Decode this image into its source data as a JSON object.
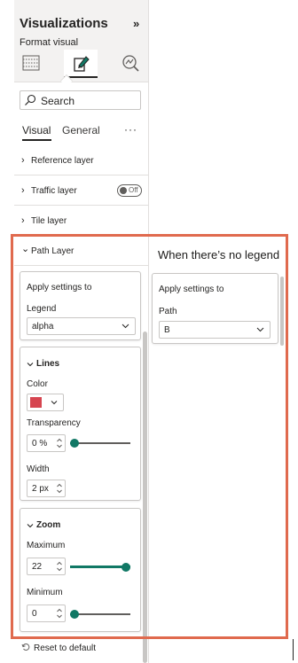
{
  "pane": {
    "title": "Visualizations",
    "collapse_glyph": "»",
    "subtitle": "Format visual",
    "icons": [
      "build-visual-icon",
      "format-visual-icon",
      "analytics-icon"
    ]
  },
  "search": {
    "placeholder": "Search",
    "icon": "search-icon"
  },
  "tabs": [
    {
      "label": "Visual",
      "active": true
    },
    {
      "label": "General",
      "active": false
    }
  ],
  "more_glyph": "···",
  "sections": {
    "reference": {
      "label": "Reference layer",
      "chevron": "›"
    },
    "traffic": {
      "label": "Traffic layer",
      "chevron": "›",
      "toggle_label": "Off"
    },
    "tile": {
      "label": "Tile layer",
      "chevron": "›"
    },
    "path": {
      "label": "Path Layer",
      "chevron": "⌄"
    }
  },
  "apply_card": {
    "title": "Apply settings to",
    "field_label": "Legend",
    "value": "alpha"
  },
  "lines_card": {
    "title": "Lines",
    "color_label": "Color",
    "color_value": "#d64550",
    "transparency_label": "Transparency",
    "transparency_value": "0 %",
    "transparency_level": 0,
    "width_label": "Width",
    "width_value": "2 px"
  },
  "zoom_card": {
    "title": "Zoom",
    "max_label": "Maximum",
    "max_value": "22",
    "max_level": 1,
    "min_label": "Minimum",
    "min_value": "0",
    "min_level": 0
  },
  "reset_label": "Reset to default",
  "no_legend": {
    "heading": "When there’s no legend",
    "card_title": "Apply settings to",
    "field_label": "Path",
    "value": "B"
  },
  "colors": {
    "accent": "#117865",
    "highlight_border": "#e06a4e"
  }
}
